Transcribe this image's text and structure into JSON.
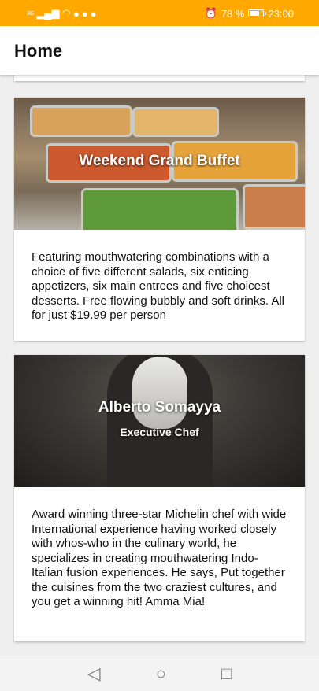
{
  "status": {
    "left_icons": [
      "signal-icon",
      "wifi-icon",
      "app-icon-a",
      "app-icon-b",
      "app-icon-c"
    ],
    "network": "3G",
    "battery": "78 %",
    "battery_level": 0.78,
    "time": "23:00"
  },
  "app_bar": {
    "title": "Home"
  },
  "cards": [
    {
      "image": "buffet-food-image",
      "title": "Weekend Grand Buffet",
      "body": "Featuring mouthwatering combinations with a choice of five different salads, six enticing appetizers, six main entrees and five choicest desserts. Free flowing bubbly and soft drinks. All for just $19.99 per person"
    },
    {
      "image": "chef-portrait-image",
      "title": "Alberto Somayya",
      "subtitle": "Executive Chef",
      "body": "Award winning three-star Michelin chef with wide International experience having worked closely with whos-who in the culinary world, he specializes in creating mouthwatering Indo-Italian fusion experiences. He says, Put together the cuisines from the two craziest cultures, and you get a winning hit! Amma Mia!"
    }
  ],
  "nav": {
    "icons": [
      "back-icon",
      "home-icon",
      "recents-icon"
    ]
  }
}
